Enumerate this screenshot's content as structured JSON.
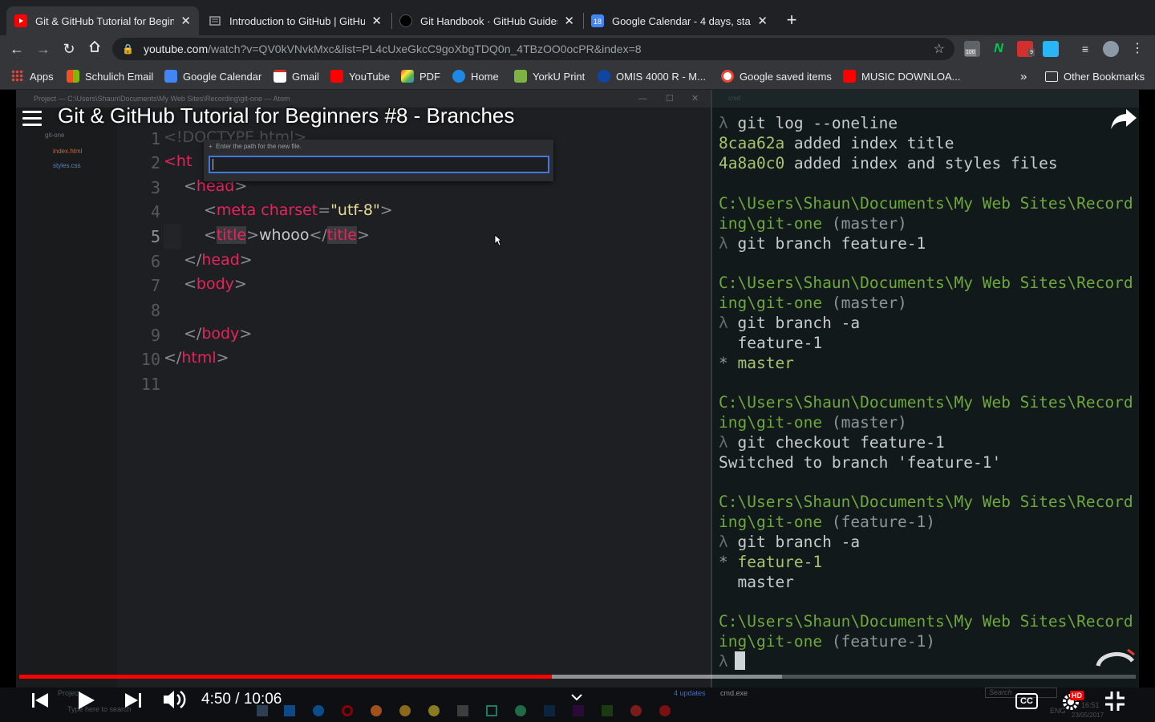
{
  "browser": {
    "tabs": [
      {
        "label": "Git & GitHub Tutorial for Beginn",
        "icon": "youtube-icon",
        "color": "#ff0000",
        "active": true
      },
      {
        "label": "Introduction to GitHub | GitHub",
        "icon": "document-icon",
        "color": "#9aa0a6",
        "active": false
      },
      {
        "label": "Git Handbook · GitHub Guides",
        "icon": "github-icon",
        "color": "#000000",
        "active": false
      },
      {
        "label": "Google Calendar - 4 days, star",
        "icon": "calendar-icon",
        "color": "#4285f4",
        "active": false
      }
    ],
    "new_tab": "+",
    "url_host": "youtube.com",
    "url_path": "/watch?v=QV0kVNvkMxc&list=PL4cUxeGkcC9goXbgTDQ0n_4TBzOO0ocPR&index=8",
    "extension_badges": [
      "100",
      "9"
    ],
    "bookmarks": [
      {
        "label": "Apps",
        "icon": "apps-grid-icon"
      },
      {
        "label": "Schulich Email",
        "icon": "microsoft-icon"
      },
      {
        "label": "Google Calendar",
        "icon": "calendar-icon"
      },
      {
        "label": "Gmail",
        "icon": "gmail-icon"
      },
      {
        "label": "YouTube",
        "icon": "youtube-icon"
      },
      {
        "label": "PDF",
        "icon": "pdf-icon"
      },
      {
        "label": "Home",
        "icon": "home-icon"
      },
      {
        "label": "YorkU Print",
        "icon": "print-icon"
      },
      {
        "label": "OMIS 4000 R - M...",
        "icon": "omis-icon"
      },
      {
        "label": "Google saved items",
        "icon": "google-icon"
      },
      {
        "label": "MUSIC DOWNLOA...",
        "icon": "youtube-icon"
      }
    ],
    "overflow": "»",
    "other_bookmarks": "Other Bookmarks"
  },
  "video": {
    "title": "Git & GitHub Tutorial for Beginners #8 - Branches",
    "time": "4:50 / 10:06",
    "progress_played": 0.477,
    "progress_loaded": 0.683,
    "hd_badge": "HD",
    "atom": {
      "window_title": "Project — C:\\Users\\Shaun\\Documents\\My Web Sites\\Recording\\git-one — Atom",
      "tree": [
        "git-one",
        "index.html",
        "styles.css"
      ],
      "new_file_prompt": "Enter the path for the new file.",
      "line_numbers": [
        "1",
        "2",
        "3",
        "4",
        "5",
        "6",
        "7",
        "8",
        "9",
        "10",
        "11"
      ],
      "code": {
        "l1": "<!DOCTYPE html>",
        "l2_tag": "<ht",
        "l3_tag": "head",
        "l4_tag": "meta",
        "l4_attr": "charset",
        "l4_val": "\"utf-8\"",
        "l5_tag": "title",
        "l5_text": "whooo",
        "l6_tag": "head",
        "l7_tag": "body",
        "l9_tag": "body",
        "l10_tag": "html"
      },
      "status_left": "Project",
      "status_right": "4 updates"
    },
    "terminal": {
      "window_title": "cmd",
      "lines": [
        {
          "lam": "λ ",
          "text": "git log --oneline"
        },
        {
          "hash": "8caa62a",
          "text": " added index title"
        },
        {
          "hash": "4a8a0c0",
          "text": " added index and styles files"
        },
        {
          "path": "C:\\Users\\Shaun\\Documents\\My Web Sites\\Record"
        },
        {
          "path": "ing\\git-one",
          "branch": " (master)"
        },
        {
          "lam": "λ ",
          "text": "git branch feature-1"
        },
        {
          "path": "C:\\Users\\Shaun\\Documents\\My Web Sites\\Record"
        },
        {
          "path": "ing\\git-one",
          "branch": " (master)"
        },
        {
          "lam": "λ ",
          "text": "git branch -a"
        },
        {
          "text": "  feature-1"
        },
        {
          "star": "* ",
          "active": "master"
        },
        {
          "path": "C:\\Users\\Shaun\\Documents\\My Web Sites\\Record"
        },
        {
          "path": "ing\\git-one",
          "branch": " (master)"
        },
        {
          "lam": "λ ",
          "text": "git checkout feature-1"
        },
        {
          "text": "Switched to branch 'feature-1'"
        },
        {
          "path": "C:\\Users\\Shaun\\Documents\\My Web Sites\\Record"
        },
        {
          "path": "ing\\git-one",
          "branch": " (feature-1)"
        },
        {
          "lam": "λ ",
          "text": "git branch -a"
        },
        {
          "star": "* ",
          "active": "feature-1"
        },
        {
          "text": "  master"
        },
        {
          "path": "C:\\Users\\Shaun\\Documents\\My Web Sites\\Record"
        },
        {
          "path": "ing\\git-one",
          "branch": " (feature-1)"
        },
        {
          "lam": "λ "
        }
      ],
      "status_tab": "cmd.exe",
      "search_placeholder": "Search"
    },
    "taskbar": {
      "search": "Type here to search",
      "lang": "ENG",
      "clock_time": "16:51",
      "clock_date": "23/05/2017"
    }
  }
}
